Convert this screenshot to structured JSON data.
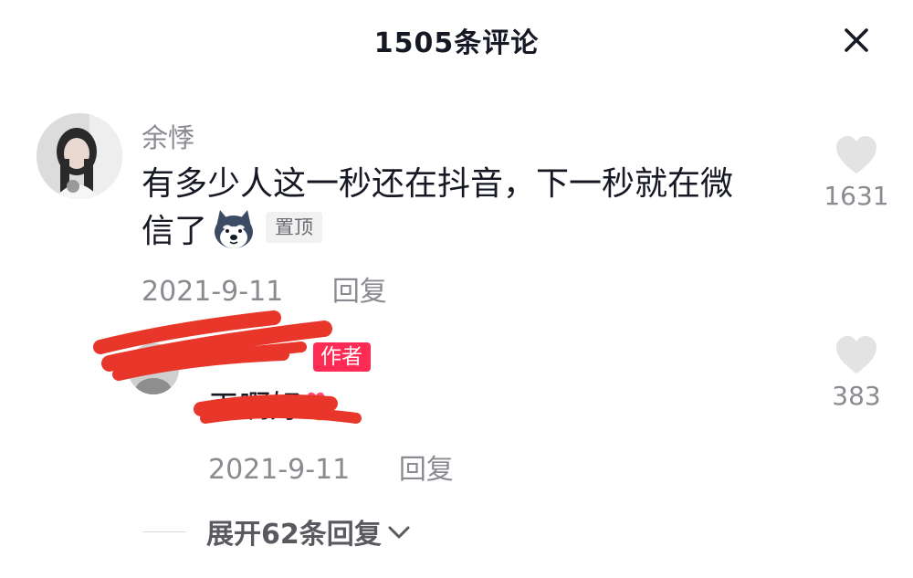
{
  "header": {
    "title": "1505条评论",
    "close_icon": "close-icon"
  },
  "comment": {
    "username": "余悸",
    "text_line1": "有多少人这一秒还在抖音，下一秒就在微",
    "text_line2": "信了",
    "emoji": "husky-dog-emoji",
    "pin_label": "置顶",
    "date": "2021-9-11",
    "reply_label": "回复",
    "like_count": "1631"
  },
  "reply": {
    "author_badge": "作者",
    "text": "天啊好",
    "emoji": "finger-heart-emoji",
    "date": "2021-9-11",
    "reply_label": "回复",
    "like_count": "383"
  },
  "expand": {
    "label": "展开62条回复",
    "icon": "chevron-down-icon"
  },
  "colors": {
    "text_primary": "#161823",
    "text_secondary": "#8a8b91",
    "author_badge_bg": "#fe2c55",
    "redaction": "#e8362a",
    "like_icon": "#e3e3e4"
  }
}
